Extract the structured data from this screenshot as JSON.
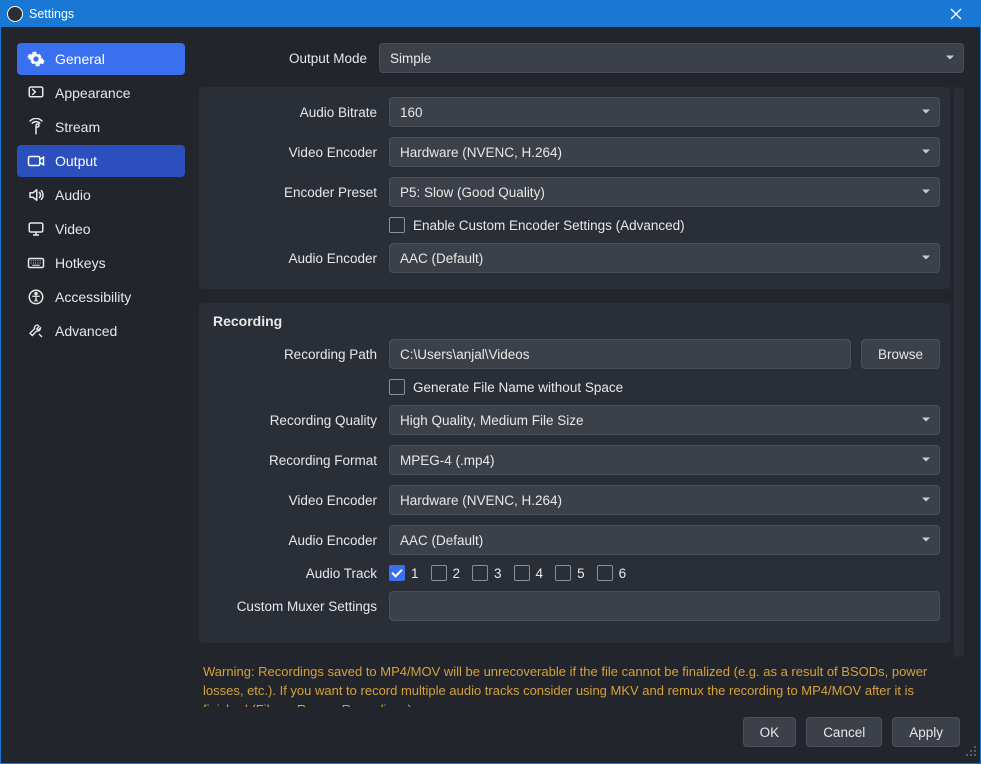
{
  "window": {
    "title": "Settings"
  },
  "sidebar": {
    "items": [
      {
        "label": "General"
      },
      {
        "label": "Appearance"
      },
      {
        "label": "Stream"
      },
      {
        "label": "Output"
      },
      {
        "label": "Audio"
      },
      {
        "label": "Video"
      },
      {
        "label": "Hotkeys"
      },
      {
        "label": "Accessibility"
      },
      {
        "label": "Advanced"
      }
    ]
  },
  "output_mode": {
    "label": "Output Mode",
    "value": "Simple"
  },
  "streaming": {
    "audio_bitrate": {
      "label": "Audio Bitrate",
      "value": "160"
    },
    "video_encoder": {
      "label": "Video Encoder",
      "value": "Hardware (NVENC, H.264)"
    },
    "encoder_preset": {
      "label": "Encoder Preset",
      "value": "P5: Slow (Good Quality)"
    },
    "enable_custom": {
      "label": "Enable Custom Encoder Settings (Advanced)",
      "checked": false
    },
    "audio_encoder": {
      "label": "Audio Encoder",
      "value": "AAC (Default)"
    }
  },
  "recording": {
    "title": "Recording",
    "path": {
      "label": "Recording Path",
      "value": "C:\\Users\\anjal\\Videos",
      "browse": "Browse"
    },
    "gen_no_space": {
      "label": "Generate File Name without Space",
      "checked": false
    },
    "quality": {
      "label": "Recording Quality",
      "value": "High Quality, Medium File Size"
    },
    "format": {
      "label": "Recording Format",
      "value": "MPEG-4 (.mp4)"
    },
    "video_encoder": {
      "label": "Video Encoder",
      "value": "Hardware (NVENC, H.264)"
    },
    "audio_encoder": {
      "label": "Audio Encoder",
      "value": "AAC (Default)"
    },
    "audio_track": {
      "label": "Audio Track",
      "tracks": [
        {
          "n": "1",
          "checked": true
        },
        {
          "n": "2",
          "checked": false
        },
        {
          "n": "3",
          "checked": false
        },
        {
          "n": "4",
          "checked": false
        },
        {
          "n": "5",
          "checked": false
        },
        {
          "n": "6",
          "checked": false
        }
      ]
    },
    "muxer": {
      "label": "Custom Muxer Settings",
      "value": ""
    }
  },
  "warning": "Warning: Recordings saved to MP4/MOV will be unrecoverable if the file cannot be finalized (e.g. as a result of BSODs, power losses, etc.). If you want to record multiple audio tracks consider using MKV and remux the recording to MP4/MOV after it is finished (File → Remux Recordings)",
  "footer": {
    "ok": "OK",
    "cancel": "Cancel",
    "apply": "Apply"
  }
}
